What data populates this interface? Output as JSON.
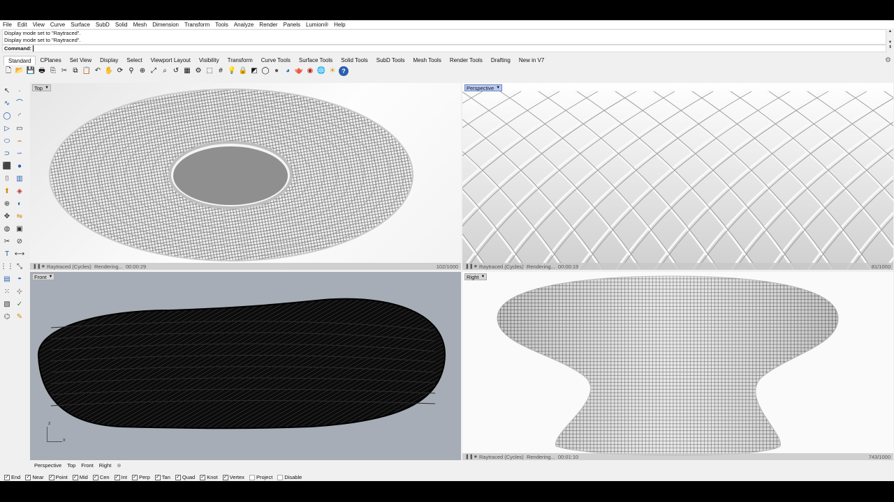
{
  "menu": [
    "File",
    "Edit",
    "View",
    "Curve",
    "Surface",
    "SubD",
    "Solid",
    "Mesh",
    "Dimension",
    "Transform",
    "Tools",
    "Analyze",
    "Render",
    "Panels",
    "Lumion®",
    "Help"
  ],
  "history": [
    "Display mode set to \"Raytraced\".",
    "Display mode set to \"Raytraced\"."
  ],
  "command_label": "Command:",
  "tabs": [
    "Standard",
    "CPlanes",
    "Set View",
    "Display",
    "Select",
    "Viewport Layout",
    "Visibility",
    "Transform",
    "Curve Tools",
    "Surface Tools",
    "Solid Tools",
    "SubD Tools",
    "Mesh Tools",
    "Render Tools",
    "Drafting",
    "New in V7"
  ],
  "active_tab": "Standard",
  "standard_icons": [
    "new-file-icon",
    "open-file-icon",
    "save-icon",
    "print-icon",
    "import-icon",
    "cut-icon",
    "copy-icon",
    "paste-icon",
    "undo-icon",
    "pan-icon",
    "rotate-view-icon",
    "zoom-icon",
    "zoom-window-icon",
    "zoom-extents-icon",
    "zoom-selected-icon",
    "undo-view-icon",
    "four-view-icon",
    "options-icon",
    "select-all-icon",
    "grid-icon",
    "lights-icon",
    "lock-icon",
    "layer-icon",
    "wireframe-icon",
    "shaded-icon",
    "rendered-icon",
    "render-icon",
    "material-icon",
    "environment-icon",
    "sun-icon",
    "help-icon"
  ],
  "left_tools": [
    [
      "select-icon",
      "point-icon"
    ],
    [
      "polyline-icon",
      "curve-icon"
    ],
    [
      "circle-icon",
      "arc-icon"
    ],
    [
      "rectangle-icon",
      "polygon-icon"
    ],
    [
      "ellipse-icon",
      "fillet-curve-icon"
    ],
    [
      "offset-icon",
      "blend-curve-icon"
    ],
    [
      "box-icon",
      "sphere-icon"
    ],
    [
      "cylinder-icon",
      "surface-icon"
    ],
    [
      "extrude-icon",
      "loft-icon"
    ],
    [
      "boolean-icon",
      "shell-icon"
    ],
    [
      "move-icon",
      "mirror-icon"
    ],
    [
      "fill-icon",
      "nurbs-icon"
    ],
    [
      "trim-icon",
      "split-icon"
    ],
    [
      "text-icon",
      "dimension-icon"
    ],
    [
      "array-icon",
      "scale-icon"
    ],
    [
      "mesh-icon",
      "render-sphere-icon"
    ],
    [
      "grid-points-icon",
      "edit-points-icon"
    ],
    [
      "layer-tool-icon",
      "check-icon"
    ],
    [
      "analyze-icon",
      "paint-icon"
    ]
  ],
  "viewports": {
    "top": {
      "label": "Top"
    },
    "perspective": {
      "label": "Perspective"
    },
    "front": {
      "label": "Front"
    },
    "right": {
      "label": "Right"
    }
  },
  "status": {
    "top": {
      "mode": "Raytraced (Cycles)",
      "state": "Rendering...",
      "time": "00:00:29",
      "progress": "102/1000"
    },
    "perspective": {
      "mode": "Raytraced (Cycles)",
      "state": "Rendering...",
      "time": "00:00:19",
      "progress": "81/1000"
    },
    "right": {
      "mode": "Raytraced (Cycles)",
      "state": "Rendering...",
      "time": "00:01:10",
      "progress": "743/1000"
    }
  },
  "axis": {
    "z": "z",
    "x": "x"
  },
  "bottom_tabs": [
    "Perspective",
    "Top",
    "Front",
    "Right"
  ],
  "snaps": [
    {
      "label": "End",
      "on": true
    },
    {
      "label": "Near",
      "on": true
    },
    {
      "label": "Point",
      "on": true
    },
    {
      "label": "Mid",
      "on": true
    },
    {
      "label": "Cen",
      "on": true
    },
    {
      "label": "Int",
      "on": true
    },
    {
      "label": "Perp",
      "on": true
    },
    {
      "label": "Tan",
      "on": true
    },
    {
      "label": "Quad",
      "on": true
    },
    {
      "label": "Knot",
      "on": true
    },
    {
      "label": "Vertex",
      "on": true
    },
    {
      "label": "Project",
      "on": false
    },
    {
      "label": "Disable",
      "on": false
    }
  ]
}
